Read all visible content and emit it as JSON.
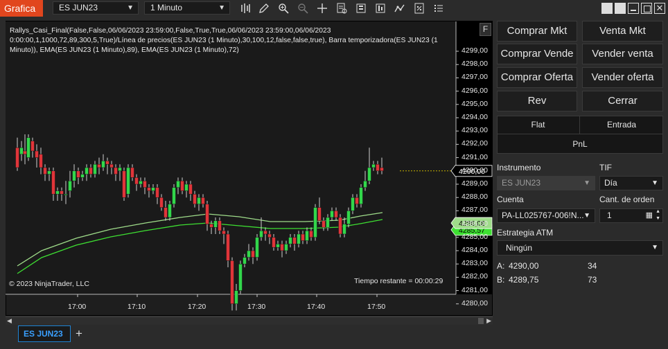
{
  "title_bar": {
    "app_tab": "Grafica",
    "instrument": "ES JUN23",
    "interval": "1 Minuto"
  },
  "chart": {
    "indicator_text": "Rallys_Casi_Final(False,False,06/06/2023 23:59:00,False,True,True,06/06/2023 23:59:00,06/06/2023 0:00:00,1,1000,72,89,300,5,True)/Línea de precios(ES JUN23 (1 Minuto),30,100,12,false,false,true), Barra temporizadora(ES JUN23 (1 Minuto)), EMA(ES JUN23 (1 Minuto),89), EMA(ES JUN23 (1 Minuto),72)",
    "f_button": "F",
    "copyright": "© 2023 NinjaTrader, LLC",
    "time_remaining": "Tiempo restante = 00:00:29",
    "price_labels": [
      "4299,00",
      "4298,00",
      "4297,00",
      "4296,00",
      "4295,00",
      "4294,00",
      "4293,00",
      "4292,00",
      "4291,00",
      "4290,00",
      "4289,00",
      "4288,00",
      "4287,00",
      "4286,00",
      "4285,00",
      "4284,00",
      "4283,00",
      "4282,00",
      "4281,00",
      "4280,00"
    ],
    "time_labels": [
      "17:00",
      "17:10",
      "17:20",
      "17:30",
      "17:40",
      "17:50"
    ],
    "last_price_marker": "4290,00",
    "ema_marker_1": "4286,08",
    "ema_marker_2": "4285,57",
    "colors": {
      "up": "#32d74b",
      "down": "#e0353a",
      "ema_light": "#9fdc8a",
      "ema_green": "#3ee032",
      "price_line": "#c8b400"
    }
  },
  "bottom_tabs": {
    "active": "ES JUN23",
    "add": "+"
  },
  "order_panel": {
    "buy_mkt": "Comprar Mkt",
    "sell_mkt": "Venta Mkt",
    "buy_bid": "Comprar Vende",
    "sell_ask": "Vender venta",
    "buy_offer": "Comprar Oferta",
    "sell_offer": "Vender oferta",
    "rev": "Rev",
    "close": "Cerrar",
    "flat": "Flat",
    "entry": "Entrada",
    "pnl": "PnL",
    "instrument_label": "Instrumento",
    "instrument_value": "ES JUN23",
    "tif_label": "TIF",
    "tif_value": "Día",
    "account_label": "Cuenta",
    "account_value": "PA-LL025767-006!N...",
    "qty_label": "Cant. de orden",
    "qty_value": "1",
    "atm_label": "Estrategia ATM",
    "atm_value": "Ningún",
    "ask_label": "A:",
    "ask_price": "4290,00",
    "ask_size": "34",
    "bid_label": "B:",
    "bid_price": "4289,75",
    "bid_size": "73"
  }
}
